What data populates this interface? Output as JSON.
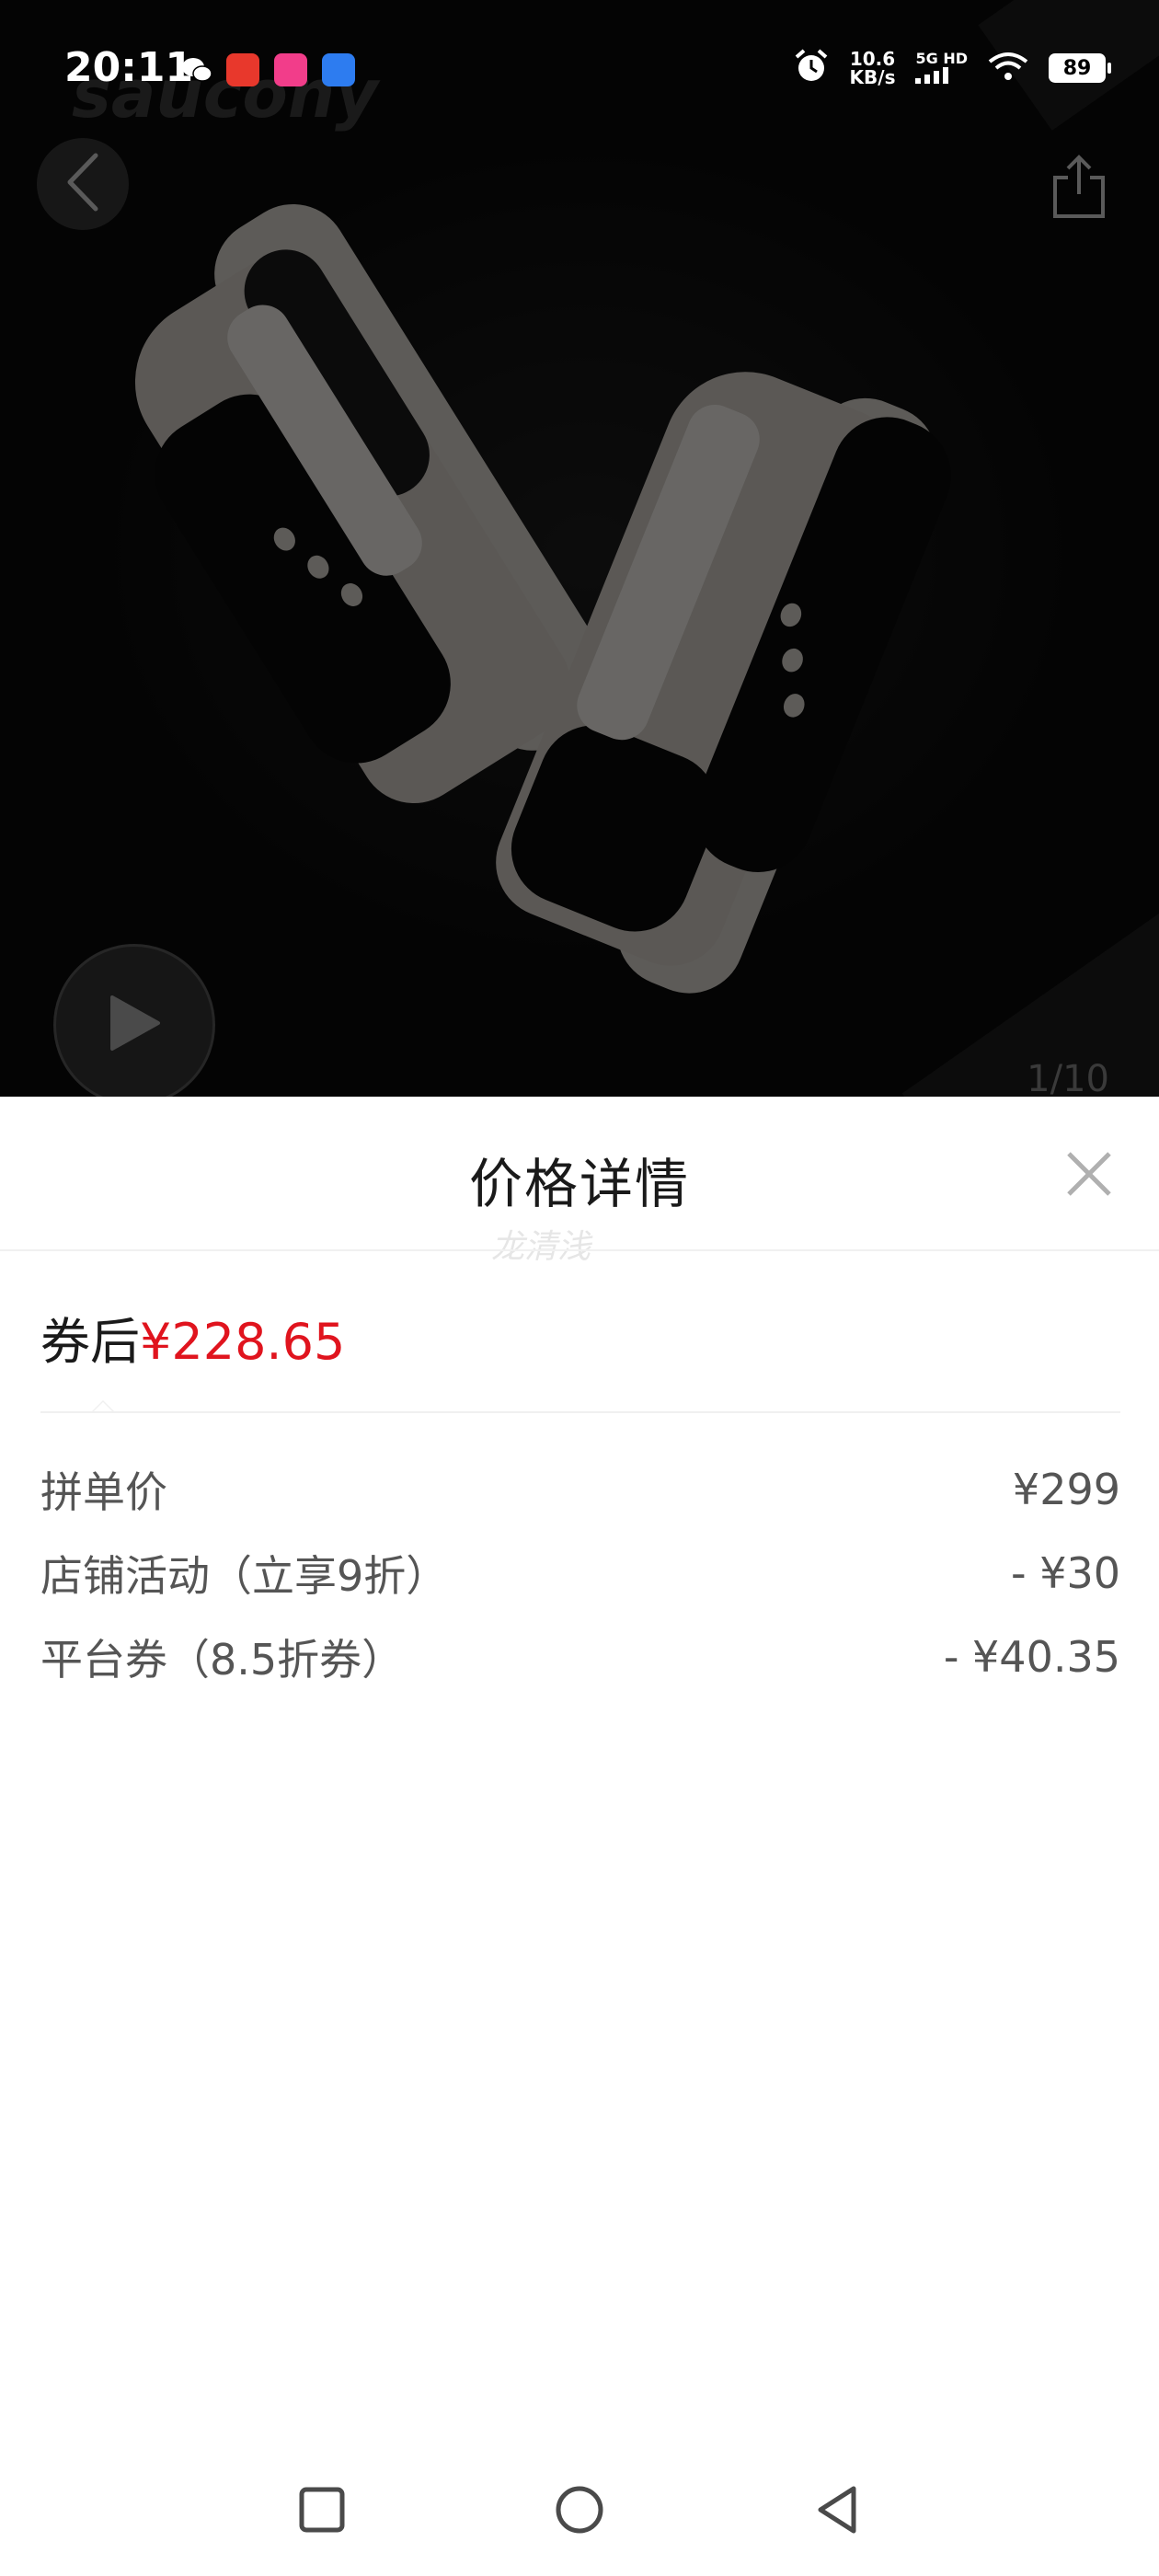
{
  "status_bar": {
    "time": "20:11",
    "net_speed_value": "10.6",
    "net_speed_unit": "KB/s",
    "signal_label": "5G HD",
    "battery": "89"
  },
  "hero": {
    "brand_watermark": "saucony",
    "image_counter": "1/10"
  },
  "price_sheet": {
    "title": "价格详情",
    "watermark": "龙清浅",
    "final_price_label": "券后",
    "final_price": "¥228.65",
    "items": [
      {
        "label": "拼单价",
        "value": "¥299"
      },
      {
        "label": "店铺活动（立享9折）",
        "value": "- ¥30"
      },
      {
        "label": "平台券（8.5折券）",
        "value": "- ¥40.35"
      }
    ]
  },
  "colors": {
    "price_red": "#e0141e",
    "text_primary": "#1a1a1a",
    "text_secondary": "#555555"
  },
  "icons": {
    "back": "chevron-left-icon",
    "share": "share-icon",
    "play": "play-icon",
    "close": "close-icon",
    "nav_recent": "square-icon",
    "nav_home": "circle-icon",
    "nav_back": "triangle-back-icon"
  }
}
